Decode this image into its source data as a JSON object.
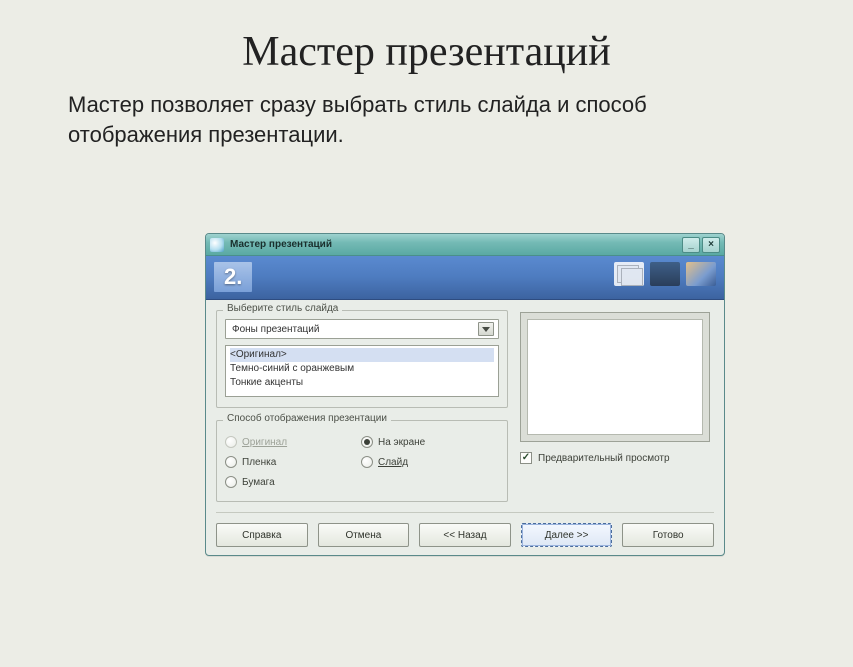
{
  "slide": {
    "title": "Мастер презентаций",
    "body": "Мастер позволяет сразу выбрать стиль слайда и способ отображения презентации."
  },
  "window": {
    "title": "Мастер презентаций",
    "minimize": "_",
    "close": "×",
    "step": "2."
  },
  "style_group": {
    "legend": "Выберите стиль слайда",
    "combo_value": "Фоны презентаций",
    "items": {
      "0": "<Оригинал>",
      "1": "Темно-синий с оранжевым",
      "2": "Тонкие акценты"
    }
  },
  "display_group": {
    "legend": "Способ отображения презентации",
    "options": {
      "original": "Оригинал",
      "screen": "На экране",
      "film": "Пленка",
      "slide": "Слайд",
      "paper": "Бумага"
    }
  },
  "preview": {
    "checkbox": "Предварительный просмотр"
  },
  "buttons": {
    "help": "Справка",
    "cancel": "Отмена",
    "back": "<< Назад",
    "next": "Далее >>",
    "finish": "Готово"
  }
}
